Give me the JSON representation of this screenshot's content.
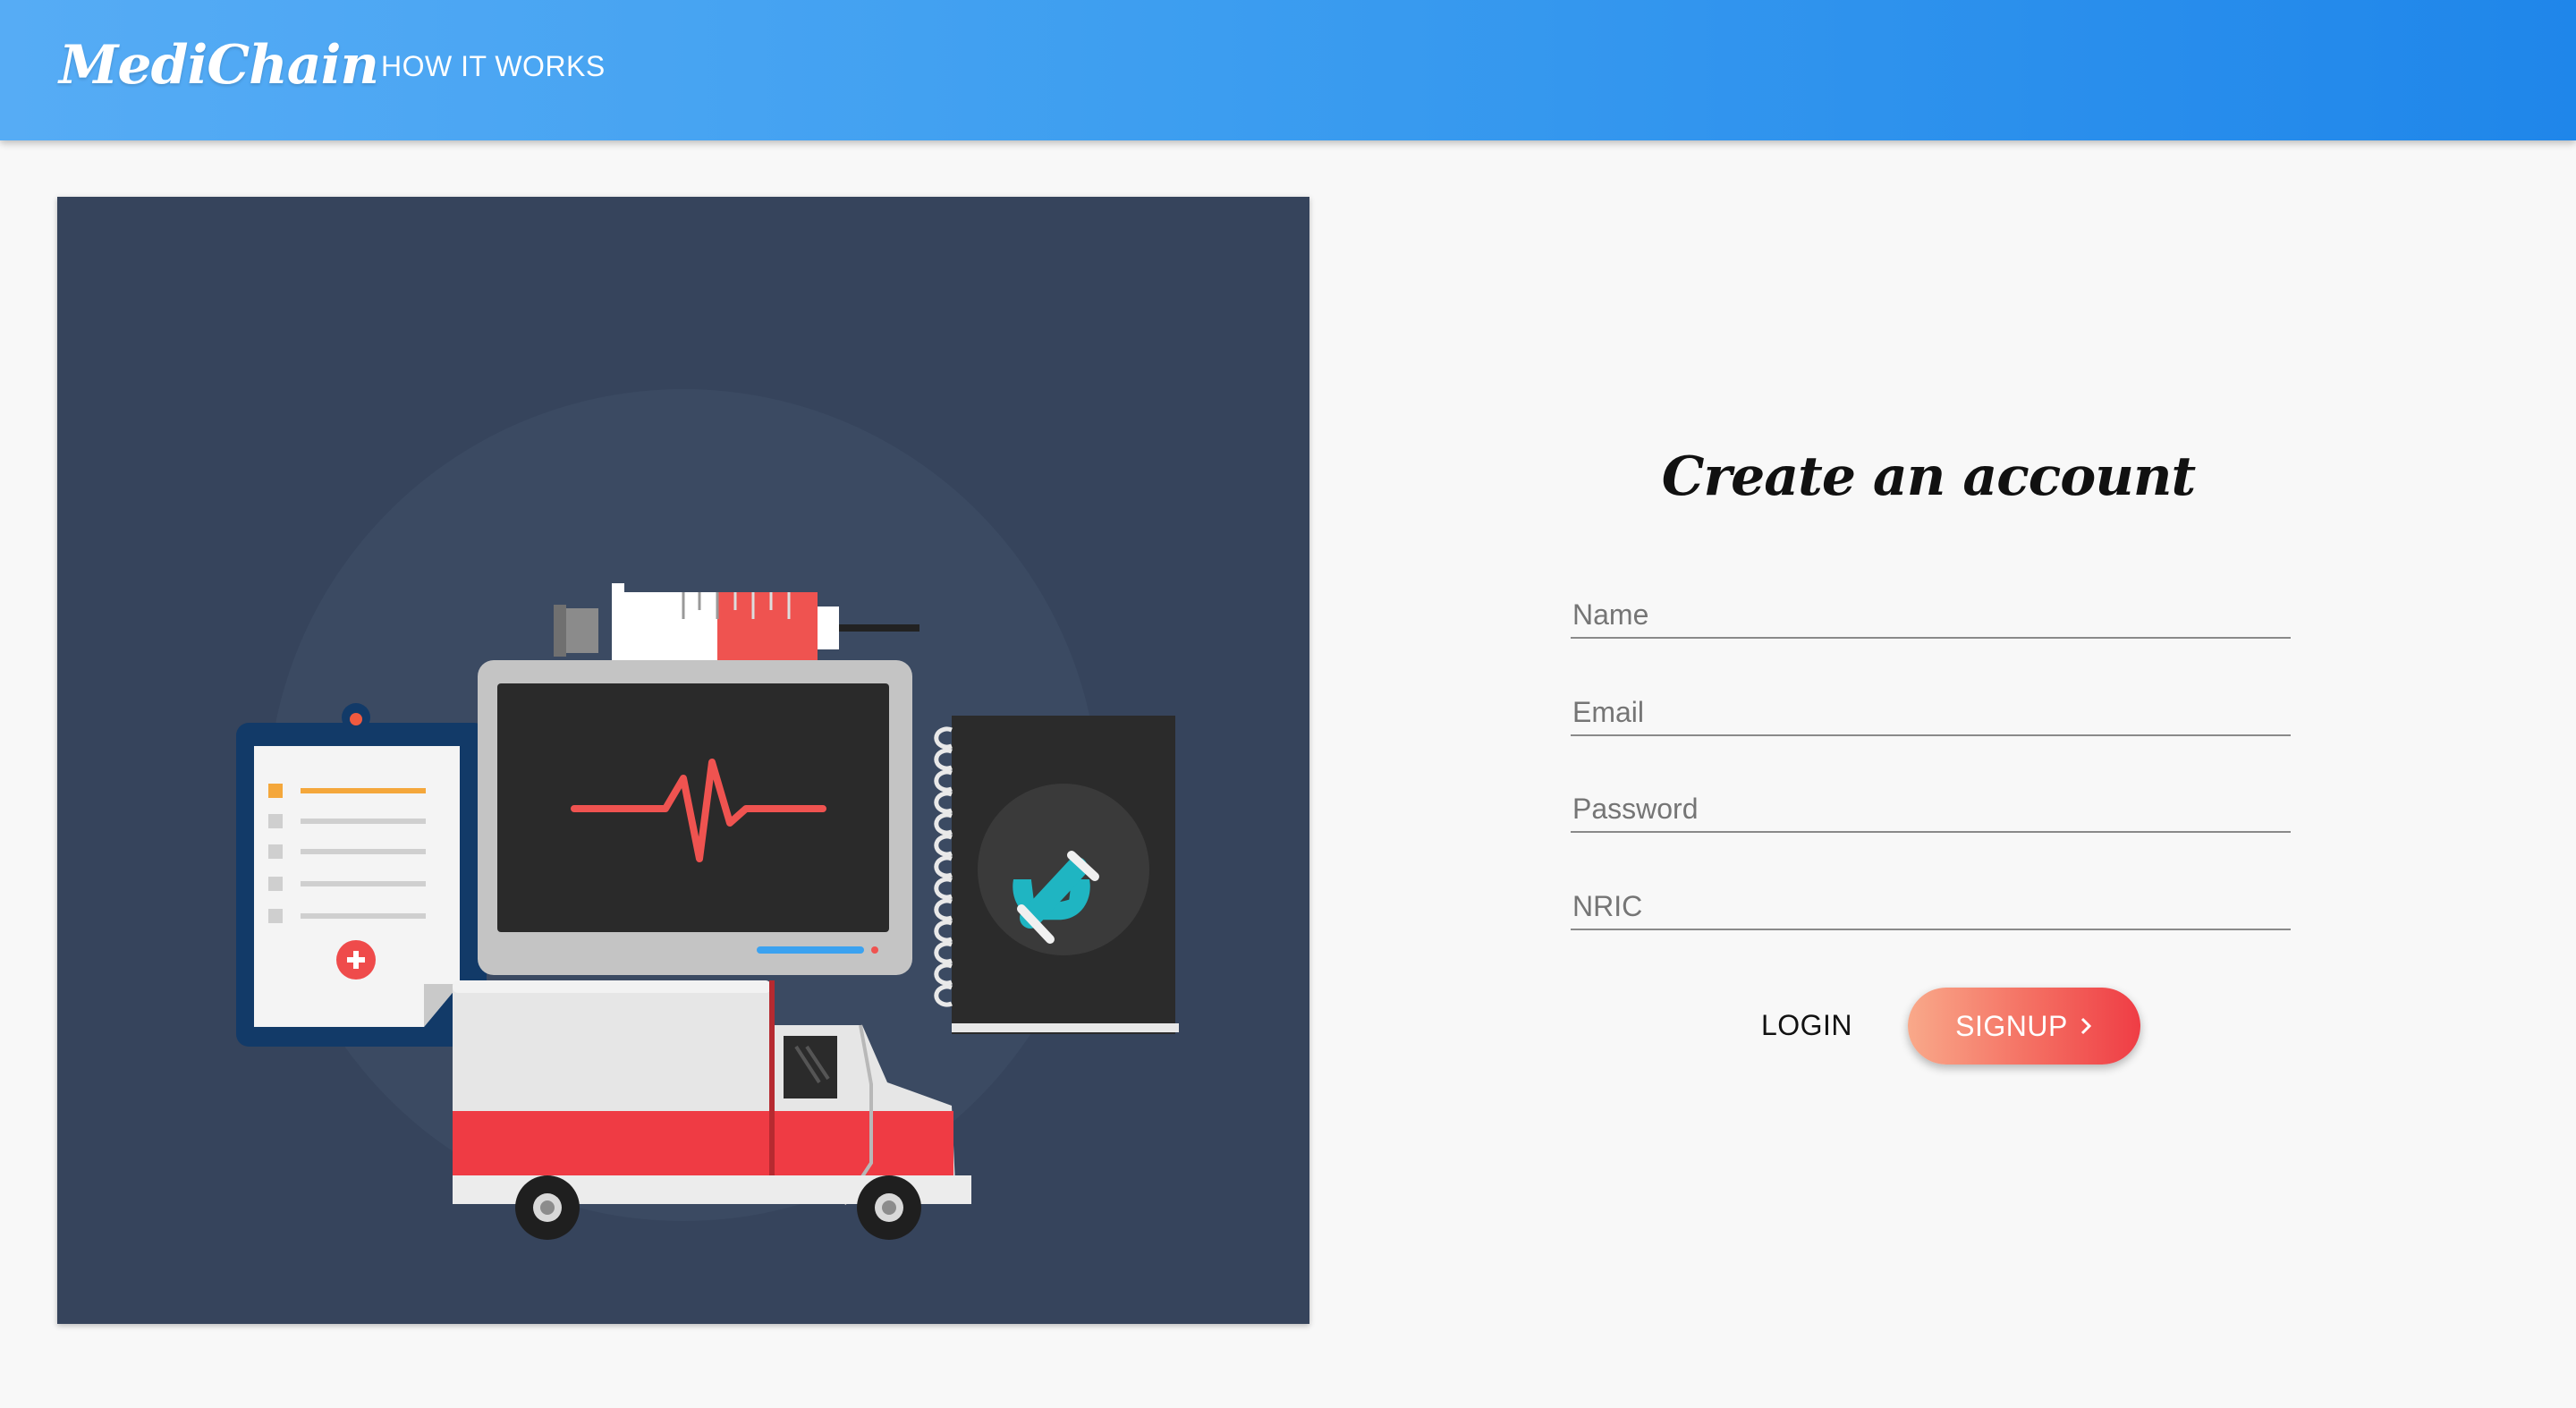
{
  "header": {
    "brand": "MediChain",
    "nav": [
      {
        "label": "HOW IT WORKS"
      }
    ]
  },
  "illustration": {
    "icons": [
      "syringe-icon",
      "heart-monitor-icon",
      "clipboard-icon",
      "phone-book-icon",
      "ambulance-icon"
    ]
  },
  "form": {
    "title": "Create an account",
    "fields": {
      "name": {
        "placeholder": "Name",
        "value": ""
      },
      "email": {
        "placeholder": "Email",
        "value": ""
      },
      "password": {
        "placeholder": "Password",
        "value": ""
      },
      "nric": {
        "placeholder": "NRIC",
        "value": ""
      }
    },
    "login_label": "LOGIN",
    "signup_label": "SIGNUP",
    "signup_icon": "chevron-right-icon"
  },
  "colors": {
    "header_gradient_start": "#56acf5",
    "header_gradient_end": "#1f86ea",
    "signup_gradient_start": "#f9a98a",
    "signup_gradient_end": "#ef3d45",
    "illustration_bg": "#36445c"
  }
}
